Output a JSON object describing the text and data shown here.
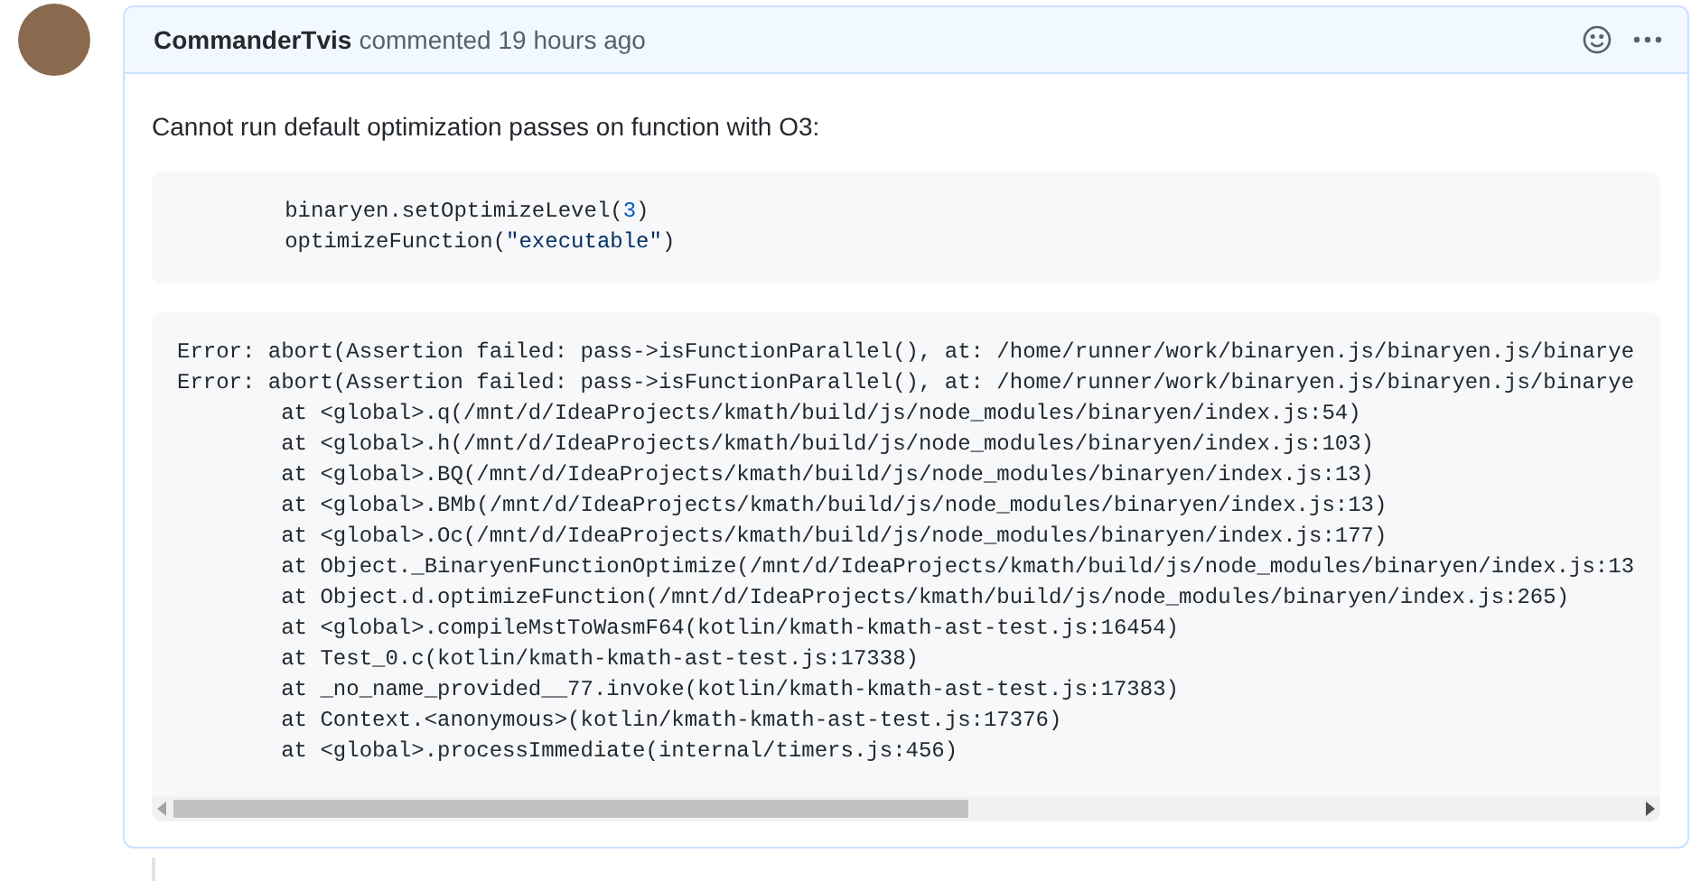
{
  "comment": {
    "author": "CommanderTvis",
    "meta": "commented 19 hours ago",
    "body": "Cannot run default optimization passes on function with O3:",
    "code_block": [
      [
        {
          "kind": "plain",
          "text": "        binaryen.setOptimizeLevel("
        },
        {
          "kind": "number",
          "text": "3"
        },
        {
          "kind": "plain",
          "text": ")"
        }
      ],
      [
        {
          "kind": "plain",
          "text": "        optimizeFunction("
        },
        {
          "kind": "string",
          "text": "\"executable\""
        },
        {
          "kind": "plain",
          "text": ")"
        }
      ]
    ],
    "error_block": [
      "Error: abort(Assertion failed: pass->isFunctionParallel(), at: /home/runner/work/binaryen.js/binaryen.js/binarye",
      "Error: abort(Assertion failed: pass->isFunctionParallel(), at: /home/runner/work/binaryen.js/binaryen.js/binarye",
      "        at <global>.q(/mnt/d/IdeaProjects/kmath/build/js/node_modules/binaryen/index.js:54)",
      "        at <global>.h(/mnt/d/IdeaProjects/kmath/build/js/node_modules/binaryen/index.js:103)",
      "        at <global>.BQ(/mnt/d/IdeaProjects/kmath/build/js/node_modules/binaryen/index.js:13)",
      "        at <global>.BMb(/mnt/d/IdeaProjects/kmath/build/js/node_modules/binaryen/index.js:13)",
      "        at <global>.Oc(/mnt/d/IdeaProjects/kmath/build/js/node_modules/binaryen/index.js:177)",
      "        at Object._BinaryenFunctionOptimize(/mnt/d/IdeaProjects/kmath/build/js/node_modules/binaryen/index.js:13",
      "        at Object.d.optimizeFunction(/mnt/d/IdeaProjects/kmath/build/js/node_modules/binaryen/index.js:265)",
      "        at <global>.compileMstToWasmF64(kotlin/kmath-kmath-ast-test.js:16454)",
      "        at Test_0.c(kotlin/kmath-kmath-ast-test.js:17338)",
      "        at _no_name_provided__77.invoke(kotlin/kmath-kmath-ast-test.js:17383)",
      "        at Context.<anonymous>(kotlin/kmath-kmath-ast-test.js:17376)",
      "        at <global>.processImmediate(internal/timers.js:456)"
    ]
  }
}
